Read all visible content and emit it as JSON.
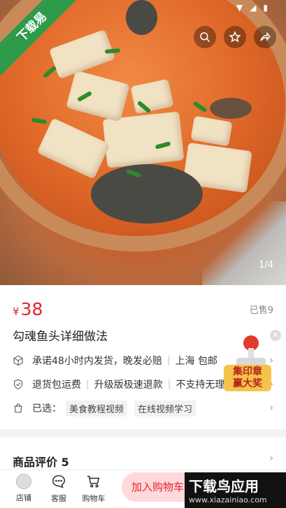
{
  "hero": {
    "corner_badge": "下载易",
    "pager": "1/4",
    "icons": [
      "search-icon",
      "star-icon",
      "share-icon"
    ]
  },
  "product": {
    "currency": "¥",
    "price": "38",
    "sold": "已售9",
    "title": "勾魂鱼头详细做法"
  },
  "info": {
    "shipping": {
      "promise": "承诺48小时内发货，晚发必赔",
      "location": "上海 包邮"
    },
    "service": {
      "returns": "退货包运费",
      "upgrade": "升级版极速退款",
      "unsupported": "不支持无理"
    },
    "selected": {
      "label": "已选：",
      "tags": [
        "美食教程视频",
        "在线视频学习"
      ]
    }
  },
  "stamp": {
    "line1": "集印章",
    "line2": "赢大奖"
  },
  "review": {
    "label": "商品评价 5"
  },
  "bottom_nav": [
    {
      "label": "店铺",
      "icon": "store-avatar-icon"
    },
    {
      "label": "客服",
      "icon": "chat-icon"
    },
    {
      "label": "购物车",
      "icon": "cart-icon"
    }
  ],
  "actions": {
    "add_to_cart": "加入购物车"
  },
  "watermark": {
    "title": "下载鸟应用",
    "url": "www.xiazainiao.com"
  }
}
